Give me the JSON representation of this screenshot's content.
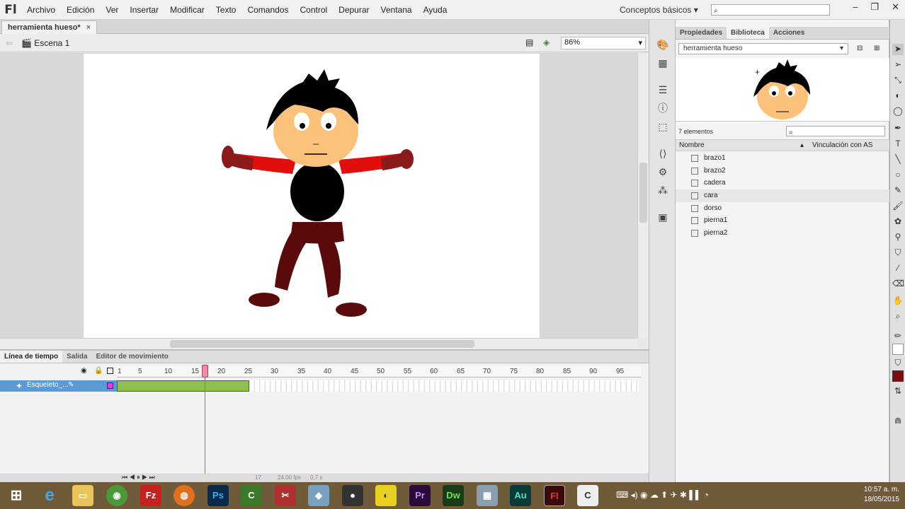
{
  "app": {
    "logo": "Fl"
  },
  "menu": [
    "Archivo",
    "Edición",
    "Ver",
    "Insertar",
    "Modificar",
    "Texto",
    "Comandos",
    "Control",
    "Depurar",
    "Ventana",
    "Ayuda"
  ],
  "workspace": "Conceptos básicos",
  "document": {
    "tab": "herramienta hueso*",
    "close": "×",
    "scene": "Escena 1",
    "zoom": "86%"
  },
  "timeline": {
    "tabs": [
      "Línea de tiempo",
      "Salida",
      "Editor de movimiento"
    ],
    "ruler": [
      "1",
      "5",
      "10",
      "15",
      "20",
      "25",
      "30",
      "35",
      "40",
      "45",
      "50",
      "55",
      "60",
      "65",
      "70",
      "75",
      "80",
      "85",
      "90",
      "95"
    ],
    "layer": "Esqueleto_...",
    "current_frame": "17",
    "fps": "24,00 fps",
    "time": "0,7 s"
  },
  "library": {
    "tabs": [
      "Propiedades",
      "Biblioteca",
      "Acciones"
    ],
    "selected": "herramienta hueso",
    "count": "7 elementos",
    "columns": [
      "Nombre",
      "Vinculación con AS"
    ],
    "items": [
      "brazo1",
      "brazo2",
      "cadera",
      "cara",
      "dorso",
      "pierna1",
      "pierna2"
    ]
  },
  "taskbar": {
    "apps": [
      "e",
      "Fz",
      "Ps",
      "Pr",
      "Dw",
      "Au",
      "Fl"
    ],
    "time": "10:57 a. m.",
    "date": "18/05/2015"
  }
}
